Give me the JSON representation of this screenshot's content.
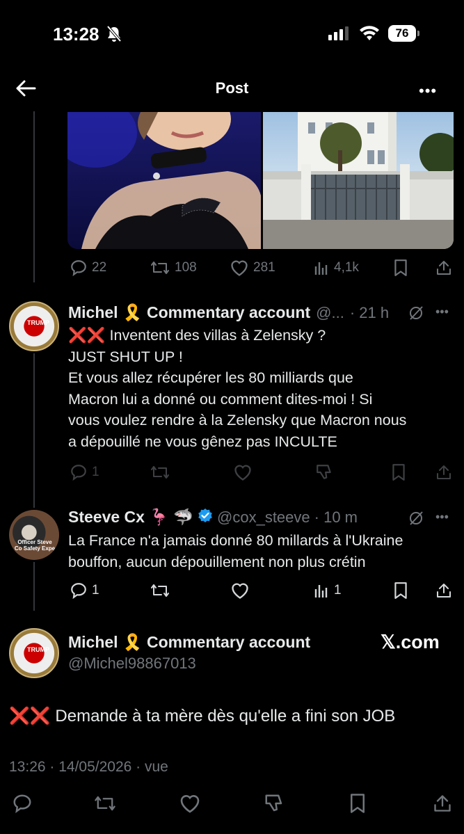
{
  "status_bar": {
    "time": "13:28",
    "battery": "76"
  },
  "header": {
    "title": "Post"
  },
  "original_post": {
    "stats": {
      "replies": "22",
      "reposts": "108",
      "likes": "281",
      "views": "4,1k"
    }
  },
  "reply1": {
    "name": "Michel 🎗️ Commentary account",
    "handle": "@...",
    "time": "· 21 h",
    "prefix": "❌❌",
    "text_line1": " Inventent des villas à Zelensky ?",
    "text_line2": "JUST SHUT UP !",
    "text_line3": "Et vous allez récupérer les 80 milliards que",
    "text_line4": "Macron lui a donné ou comment dites-moi ! Si",
    "text_line5": "vous voulez rendre à la Zelensky que Macron nous",
    "text_line6": "a dépouillé ne vous gênez pas  INCULTE",
    "replies": "1"
  },
  "reply2": {
    "name": "Steeve Cx 🦩 🦈",
    "handle": "@cox_steeve",
    "time": "· 10 m",
    "text_line1": "La France n'a jamais donné 80 millards à l'Ukraine",
    "text_line2": "bouffon, aucun dépouillement non plus crétin",
    "replies": "1",
    "views": "1",
    "avatar_text": "Officer Steve Co Safety Expe"
  },
  "main_post": {
    "name": "Michel 🎗️ Commentary account",
    "handle": "@Michel98867013",
    "watermark": "𝕏.com",
    "prefix": "❌❌",
    "text": " Demande à ta mère dès qu'elle a fini son JOB",
    "meta": "13:26 · 14/05/2026 · vue"
  },
  "icons": [
    "back-arrow-icon",
    "more-icon",
    "reply-icon",
    "repost-icon",
    "like-icon",
    "views-icon",
    "bookmark-icon",
    "share-icon",
    "verified-badge-icon",
    "grok-icon",
    "bell-slash-icon",
    "wifi-icon",
    "signal-icon"
  ],
  "colors": {
    "background": "#000000",
    "text": "#e7e9ea",
    "muted": "#71767b",
    "verified": "#1d9bf0",
    "red_x": "#e0245e"
  }
}
